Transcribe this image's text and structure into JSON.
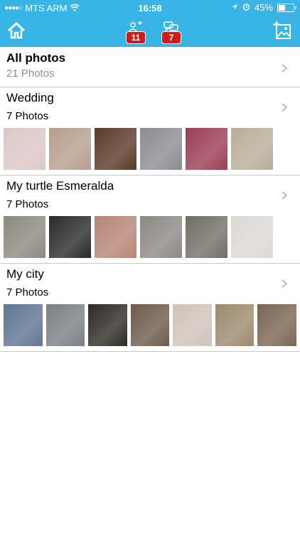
{
  "status_bar": {
    "carrier": "MTS ARM",
    "time": "16:58",
    "battery": "45%",
    "battery_level": 0.45
  },
  "nav": {
    "badge_friends": "11",
    "badge_messages": "7"
  },
  "albums": [
    {
      "title": "All photos",
      "count": "21 Photos"
    },
    {
      "title": "Wedding",
      "count": "7 Photos",
      "thumb_colors": [
        "#dcc7c6",
        "#b79e8d",
        "#5b3a28",
        "#8d8c91",
        "#9b3e55",
        "#b9ad99"
      ]
    },
    {
      "title": "My turtle Esmeralda",
      "count": "7 Photos",
      "thumb_colors": [
        "#8c8a7e",
        "#2a2a2b",
        "#b68676",
        "#8c8985",
        "#716f65",
        "#dcd8d6"
      ]
    },
    {
      "title": "My city",
      "count": "7 Photos",
      "thumb_colors": [
        "#5f7591",
        "#7a7f86",
        "#2d2b24",
        "#6d5a4c",
        "#cfc3ba",
        "#9b8a6e",
        "#7a6552"
      ]
    }
  ]
}
